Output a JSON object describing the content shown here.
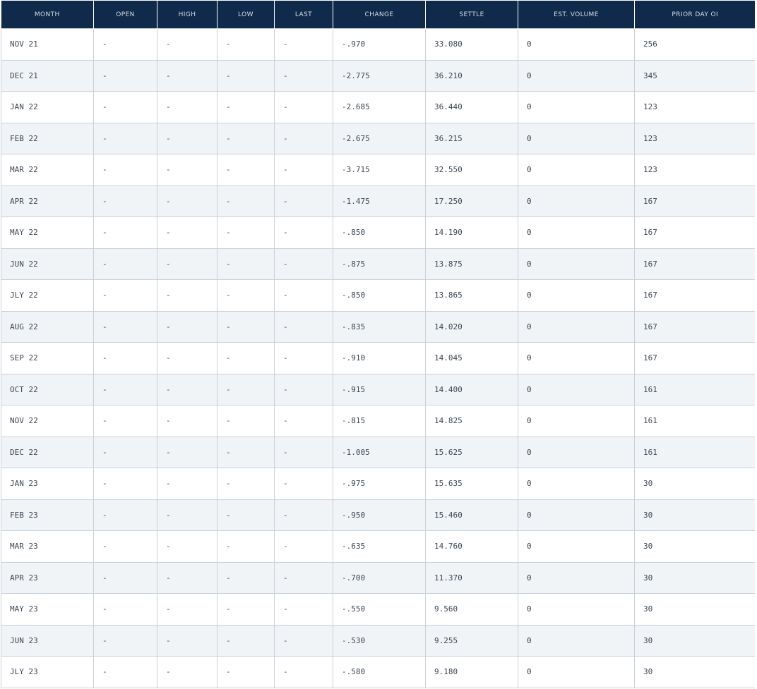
{
  "columns": [
    "MONTH",
    "OPEN",
    "HIGH",
    "LOW",
    "LAST",
    "CHANGE",
    "SETTLE",
    "EST. VOLUME",
    "PRIOR DAY OI"
  ],
  "rows": [
    [
      "NOV 21",
      "-",
      "-",
      "-",
      "-",
      "-.970",
      "33.080",
      "0",
      "256"
    ],
    [
      "DEC 21",
      "-",
      "-",
      "-",
      "-",
      "-2.775",
      "36.210",
      "0",
      "345"
    ],
    [
      "JAN 22",
      "-",
      "-",
      "-",
      "-",
      "-2.685",
      "36.440",
      "0",
      "123"
    ],
    [
      "FEB 22",
      "-",
      "-",
      "-",
      "-",
      "-2.675",
      "36.215",
      "0",
      "123"
    ],
    [
      "MAR 22",
      "-",
      "-",
      "-",
      "-",
      "-3.715",
      "32.550",
      "0",
      "123"
    ],
    [
      "APR 22",
      "-",
      "-",
      "-",
      "-",
      "-1.475",
      "17.250",
      "0",
      "167"
    ],
    [
      "MAY 22",
      "-",
      "-",
      "-",
      "-",
      "-.850",
      "14.190",
      "0",
      "167"
    ],
    [
      "JUN 22",
      "-",
      "-",
      "-",
      "-",
      "-.875",
      "13.875",
      "0",
      "167"
    ],
    [
      "JLY 22",
      "-",
      "-",
      "-",
      "-",
      "-.850",
      "13.865",
      "0",
      "167"
    ],
    [
      "AUG 22",
      "-",
      "-",
      "-",
      "-",
      "-.835",
      "14.020",
      "0",
      "167"
    ],
    [
      "SEP 22",
      "-",
      "-",
      "-",
      "-",
      "-.910",
      "14.045",
      "0",
      "167"
    ],
    [
      "OCT 22",
      "-",
      "-",
      "-",
      "-",
      "-.915",
      "14.400",
      "0",
      "161"
    ],
    [
      "NOV 22",
      "-",
      "-",
      "-",
      "-",
      "-.815",
      "14.825",
      "0",
      "161"
    ],
    [
      "DEC 22",
      "-",
      "-",
      "-",
      "-",
      "-1.005",
      "15.625",
      "0",
      "161"
    ],
    [
      "JAN 23",
      "-",
      "-",
      "-",
      "-",
      "-.975",
      "15.635",
      "0",
      "30"
    ],
    [
      "FEB 23",
      "-",
      "-",
      "-",
      "-",
      "-.950",
      "15.460",
      "0",
      "30"
    ],
    [
      "MAR 23",
      "-",
      "-",
      "-",
      "-",
      "-.635",
      "14.760",
      "0",
      "30"
    ],
    [
      "APR 23",
      "-",
      "-",
      "-",
      "-",
      "-.700",
      "11.370",
      "0",
      "30"
    ],
    [
      "MAY 23",
      "-",
      "-",
      "-",
      "-",
      "-.550",
      "9.560",
      "0",
      "30"
    ],
    [
      "JUN 23",
      "-",
      "-",
      "-",
      "-",
      "-.530",
      "9.255",
      "0",
      "30"
    ],
    [
      "JLY 23",
      "-",
      "-",
      "-",
      "-",
      "-.580",
      "9.180",
      "0",
      "30"
    ]
  ],
  "colors": {
    "header_bg": "#0f2a4b",
    "header_text": "#d8dde6",
    "row_alt_bg": "#f0f4f7",
    "border": "#c9d0d8",
    "cell_text": "#3d4653"
  }
}
